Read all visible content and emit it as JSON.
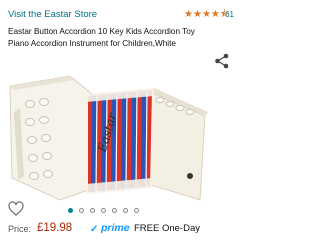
{
  "store": {
    "link_text": "Visit the Eastar Store"
  },
  "rating": {
    "stars": 4.5,
    "count": "61"
  },
  "product": {
    "title": "Eastar Button Accordion 10 Key Kids Accordion Toy Piano Accordion Instrument for Children,White"
  },
  "gallery": {
    "image_count": 7,
    "active_index": 0,
    "brand_mark": "Eastar"
  },
  "price": {
    "label": "Price:",
    "value": "£19.98",
    "prime_label": "prime",
    "delivery": "FREE One-Day"
  },
  "icons": {
    "share": "share-icon",
    "wishlist": "heart-icon",
    "prime": "prime-check-icon"
  },
  "colors": {
    "link": "#007185",
    "star": "#de7921",
    "price": "#b12704",
    "prime": "#1399ff"
  }
}
